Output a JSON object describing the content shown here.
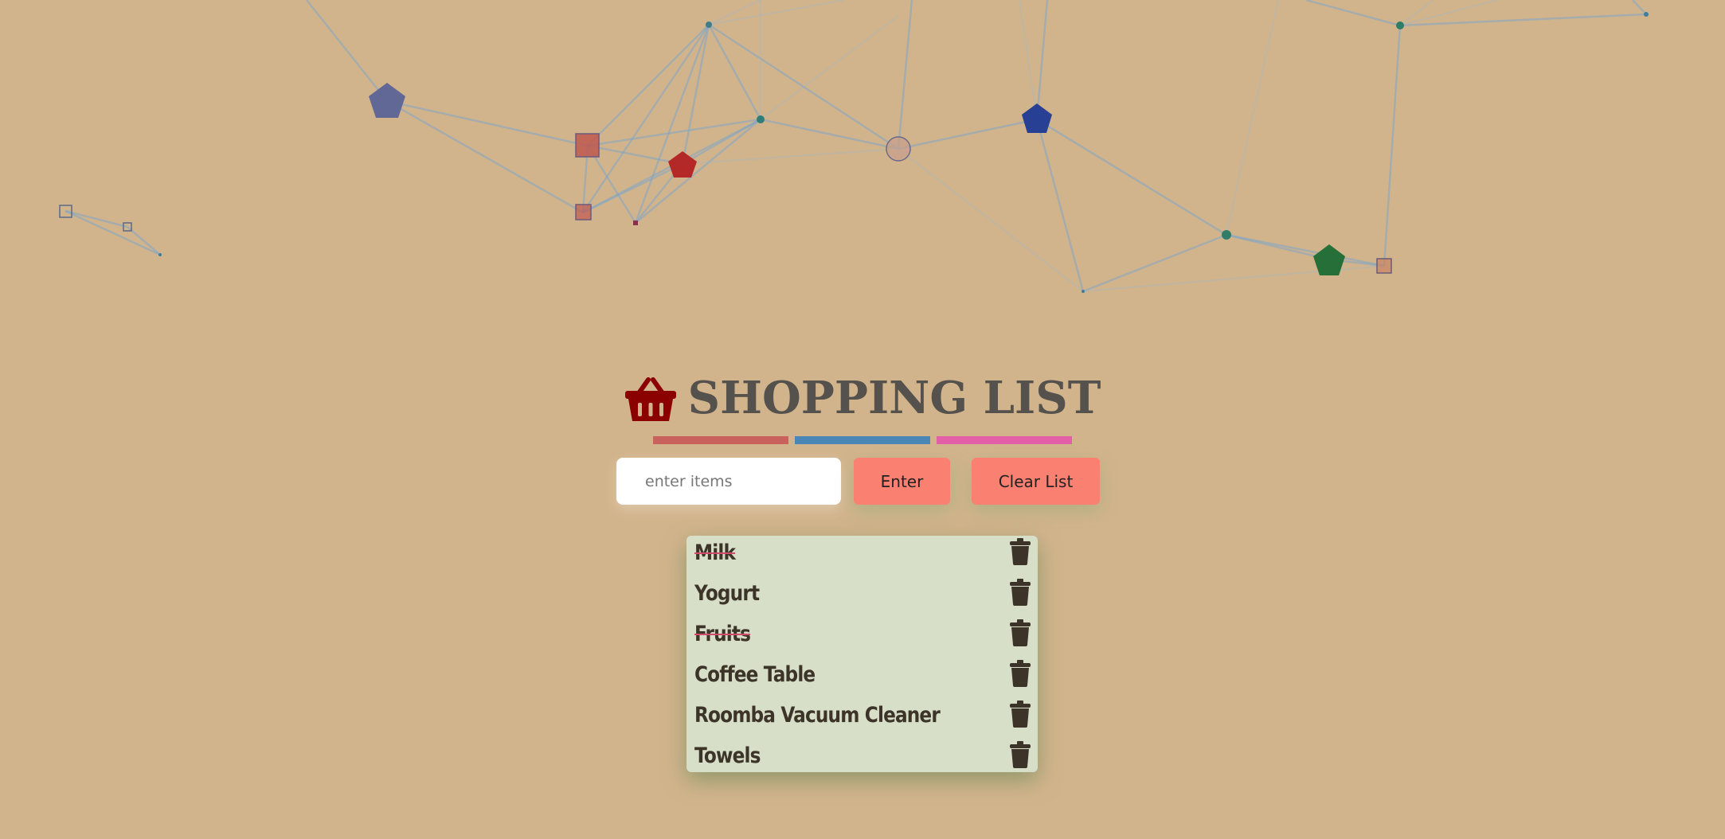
{
  "header": {
    "title": "SHOPPING LIST",
    "icon": "shopping-basket-icon",
    "underline_colors": [
      "#c9625d",
      "#4a86b5",
      "#e35fa8"
    ]
  },
  "form": {
    "input_placeholder": "enter items",
    "input_value": "",
    "enter_label": "Enter",
    "clear_label": "Clear List"
  },
  "list": {
    "items": [
      {
        "label": "Milk",
        "done": true
      },
      {
        "label": "Yogurt",
        "done": false
      },
      {
        "label": "Fruits",
        "done": true
      },
      {
        "label": "Coffee Table",
        "done": false
      },
      {
        "label": "Roomba Vacuum Cleaner",
        "done": false
      },
      {
        "label": "Towels",
        "done": false
      }
    ],
    "delete_icon": "trash-icon"
  },
  "colors": {
    "background": "#d2b48c",
    "accent_button": "#fa8072",
    "list_background": "#d8dfc8",
    "title_text": "#55514c",
    "item_text": "#3d3429",
    "basket": "#8b0000"
  }
}
